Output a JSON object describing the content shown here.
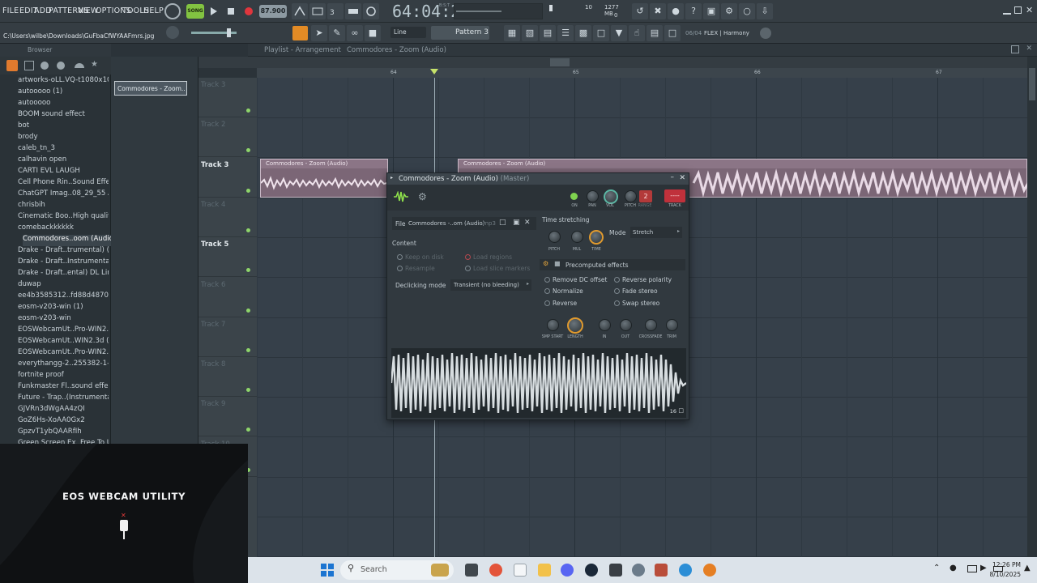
{
  "menus": [
    "FILE",
    "EDIT",
    "ADD",
    "PATTERNS",
    "VIEW",
    "OPTIONS",
    "TOOLS",
    "HELP"
  ],
  "song_label": "SONG",
  "tempo": "87.900",
  "time_display": "64:04:20",
  "time_sub": "B:S:T",
  "cpu": {
    "cpu_value": "10",
    "mem_value": "1277 MB",
    "poly_value": "0"
  },
  "hint_path": "C:\\Users\\wilbe\\Downloads\\GuFbaCfWYAAFmrs.jpg",
  "snap_mode": "Line",
  "pattern_name": "Pattern 3",
  "flex": {
    "index": "06/04",
    "name": "FLEX | Harmony"
  },
  "browser": {
    "title": "Browser",
    "items": [
      {
        "label": "artworks-oLL.VQ-t1080x1080",
        "type": "file"
      },
      {
        "label": "autooooo (1)",
        "type": "gear"
      },
      {
        "label": "autooooo",
        "type": "gear"
      },
      {
        "label": "BOOM sound effect",
        "type": "file"
      },
      {
        "label": "bot",
        "type": "file"
      },
      {
        "label": "brody",
        "type": "file"
      },
      {
        "label": "caleb_tn_3",
        "type": "file"
      },
      {
        "label": "calhavin open",
        "type": "file"
      },
      {
        "label": "CARTI EVL LAUGH",
        "type": "file"
      },
      {
        "label": "Cell Phone Rin..Sound Effect",
        "type": "file"
      },
      {
        "label": "ChatGPT Imag..08_29_55 AM",
        "type": "file"
      },
      {
        "label": "chrisbih",
        "type": "file"
      },
      {
        "label": "Cinematic Boo..High quality]",
        "type": "file"
      },
      {
        "label": "comebackkkkkk",
        "type": "gear"
      },
      {
        "label": "Commodores..oom (Audio)",
        "type": "file",
        "selected": true
      },
      {
        "label": "Drake - Draft..trumental) (1)",
        "type": "file"
      },
      {
        "label": "Drake - Draft..Instrumental)",
        "type": "file"
      },
      {
        "label": "Drake - Draft..ental) DL Link",
        "type": "file"
      },
      {
        "label": "duwap",
        "type": "file"
      },
      {
        "label": "ee4b3585312..fd88d487036",
        "type": "file"
      },
      {
        "label": "eosm-v203-win (1)",
        "type": "doc"
      },
      {
        "label": "eosm-v203-win",
        "type": "doc"
      },
      {
        "label": "EOSWebcamUt..Pro-WIN2.3a",
        "type": "doc"
      },
      {
        "label": "EOSWebcamUt..WIN2.3d (1)",
        "type": "doc"
      },
      {
        "label": "EOSWebcamUt..Pro-WIN2.3d",
        "type": "doc"
      },
      {
        "label": "everythangg-2..255382-1-001",
        "type": "file"
      },
      {
        "label": "fortnite proof",
        "type": "file"
      },
      {
        "label": "Funkmaster Fl..sound effect",
        "type": "file"
      },
      {
        "label": "Future - Trap..(Instrumental)",
        "type": "file"
      },
      {
        "label": "GJVRn3dWgAA4zQI",
        "type": "file"
      },
      {
        "label": "GoZ6Hs-XoAA0Gx2",
        "type": "file"
      },
      {
        "label": "GpzvT1ybQAARfIh",
        "type": "file"
      },
      {
        "label": "Green Screen Ex..Free To Use",
        "type": "file"
      }
    ]
  },
  "picker_clip": "Commodores - Zoom..",
  "playlist": {
    "breadcrumb": "Playlist - Arrangement",
    "clip_crumb": "Commodores - Zoom (Audio)",
    "bars": [
      "64",
      "65",
      "66",
      "67"
    ],
    "tracks": [
      "Track 3",
      "Track 2",
      "Track 3",
      "Track 4",
      "Track 5",
      "Track 6",
      "Track 7",
      "Track 8",
      "Track 9",
      "Track 10"
    ],
    "clip_label": "Commodores - Zoom (Audio)"
  },
  "channel_dialog": {
    "title": "Commodores - Zoom (Audio)",
    "master": "(Master)",
    "knob_labels": [
      "ON",
      "PAN",
      "VOL",
      "PITCH",
      "RANGE",
      "TRACK"
    ],
    "track_value": "2",
    "track_box": "----",
    "file_label": "File",
    "file_name": "Commodores -..om (Audio)",
    "file_ext": ".mp3",
    "content_label": "Content",
    "content_opts": [
      "Keep on disk",
      "Load regions",
      "Resample",
      "Load slice markers"
    ],
    "declick_label": "Declicking mode",
    "declick_value": "Transient (no bleeding)",
    "ts_title": "Time stretching",
    "ts_knobs": [
      "PITCH",
      "MUL",
      "TIME"
    ],
    "mode_label": "Mode",
    "mode_value": "Stretch",
    "pe_title": "Precomputed effects",
    "pe_opts": [
      "Remove DC offset",
      "Reverse polarity",
      "Normalize",
      "Fade stereo",
      "Reverse",
      "Swap stereo"
    ],
    "pe_knobs": [
      "SMP START",
      "LENGTH",
      "IN",
      "OUT",
      "CROSSFADE",
      "TRIM"
    ],
    "wave_badge": "16"
  },
  "webcam": {
    "title": "EOS WEBCAM UTILITY"
  },
  "taskbar": {
    "search": "Search",
    "time": "12:26 PM",
    "date": "8/10/2025"
  }
}
